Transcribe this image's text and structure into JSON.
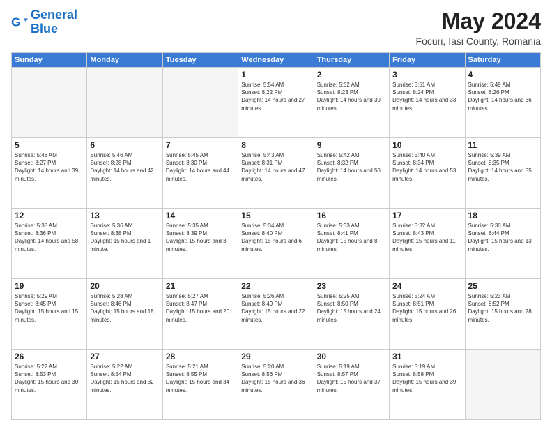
{
  "logo": {
    "line1": "General",
    "line2": "Blue"
  },
  "title": "May 2024",
  "subtitle": "Focuri, Iasi County, Romania",
  "weekdays": [
    "Sunday",
    "Monday",
    "Tuesday",
    "Wednesday",
    "Thursday",
    "Friday",
    "Saturday"
  ],
  "weeks": [
    [
      {
        "day": "",
        "empty": true
      },
      {
        "day": "",
        "empty": true
      },
      {
        "day": "",
        "empty": true
      },
      {
        "day": "1",
        "sunrise": "5:54 AM",
        "sunset": "8:22 PM",
        "daylight": "14 hours and 27 minutes."
      },
      {
        "day": "2",
        "sunrise": "5:52 AM",
        "sunset": "8:23 PM",
        "daylight": "14 hours and 30 minutes."
      },
      {
        "day": "3",
        "sunrise": "5:51 AM",
        "sunset": "8:24 PM",
        "daylight": "14 hours and 33 minutes."
      },
      {
        "day": "4",
        "sunrise": "5:49 AM",
        "sunset": "8:26 PM",
        "daylight": "14 hours and 36 minutes."
      }
    ],
    [
      {
        "day": "5",
        "sunrise": "5:48 AM",
        "sunset": "8:27 PM",
        "daylight": "14 hours and 39 minutes."
      },
      {
        "day": "6",
        "sunrise": "5:46 AM",
        "sunset": "8:28 PM",
        "daylight": "14 hours and 42 minutes."
      },
      {
        "day": "7",
        "sunrise": "5:45 AM",
        "sunset": "8:30 PM",
        "daylight": "14 hours and 44 minutes."
      },
      {
        "day": "8",
        "sunrise": "5:43 AM",
        "sunset": "8:31 PM",
        "daylight": "14 hours and 47 minutes."
      },
      {
        "day": "9",
        "sunrise": "5:42 AM",
        "sunset": "8:32 PM",
        "daylight": "14 hours and 50 minutes."
      },
      {
        "day": "10",
        "sunrise": "5:40 AM",
        "sunset": "8:34 PM",
        "daylight": "14 hours and 53 minutes."
      },
      {
        "day": "11",
        "sunrise": "5:39 AM",
        "sunset": "8:35 PM",
        "daylight": "14 hours and 55 minutes."
      }
    ],
    [
      {
        "day": "12",
        "sunrise": "5:38 AM",
        "sunset": "8:36 PM",
        "daylight": "14 hours and 58 minutes."
      },
      {
        "day": "13",
        "sunrise": "5:36 AM",
        "sunset": "8:38 PM",
        "daylight": "15 hours and 1 minute."
      },
      {
        "day": "14",
        "sunrise": "5:35 AM",
        "sunset": "8:39 PM",
        "daylight": "15 hours and 3 minutes."
      },
      {
        "day": "15",
        "sunrise": "5:34 AM",
        "sunset": "8:40 PM",
        "daylight": "15 hours and 6 minutes."
      },
      {
        "day": "16",
        "sunrise": "5:33 AM",
        "sunset": "8:41 PM",
        "daylight": "15 hours and 8 minutes."
      },
      {
        "day": "17",
        "sunrise": "5:32 AM",
        "sunset": "8:43 PM",
        "daylight": "15 hours and 11 minutes."
      },
      {
        "day": "18",
        "sunrise": "5:30 AM",
        "sunset": "8:44 PM",
        "daylight": "15 hours and 13 minutes."
      }
    ],
    [
      {
        "day": "19",
        "sunrise": "5:29 AM",
        "sunset": "8:45 PM",
        "daylight": "15 hours and 15 minutes."
      },
      {
        "day": "20",
        "sunrise": "5:28 AM",
        "sunset": "8:46 PM",
        "daylight": "15 hours and 18 minutes."
      },
      {
        "day": "21",
        "sunrise": "5:27 AM",
        "sunset": "8:47 PM",
        "daylight": "15 hours and 20 minutes."
      },
      {
        "day": "22",
        "sunrise": "5:26 AM",
        "sunset": "8:49 PM",
        "daylight": "15 hours and 22 minutes."
      },
      {
        "day": "23",
        "sunrise": "5:25 AM",
        "sunset": "8:50 PM",
        "daylight": "15 hours and 24 minutes."
      },
      {
        "day": "24",
        "sunrise": "5:24 AM",
        "sunset": "8:51 PM",
        "daylight": "15 hours and 26 minutes."
      },
      {
        "day": "25",
        "sunrise": "5:23 AM",
        "sunset": "8:52 PM",
        "daylight": "15 hours and 28 minutes."
      }
    ],
    [
      {
        "day": "26",
        "sunrise": "5:22 AM",
        "sunset": "8:53 PM",
        "daylight": "15 hours and 30 minutes."
      },
      {
        "day": "27",
        "sunrise": "5:22 AM",
        "sunset": "8:54 PM",
        "daylight": "15 hours and 32 minutes."
      },
      {
        "day": "28",
        "sunrise": "5:21 AM",
        "sunset": "8:55 PM",
        "daylight": "15 hours and 34 minutes."
      },
      {
        "day": "29",
        "sunrise": "5:20 AM",
        "sunset": "8:56 PM",
        "daylight": "15 hours and 36 minutes."
      },
      {
        "day": "30",
        "sunrise": "5:19 AM",
        "sunset": "8:57 PM",
        "daylight": "15 hours and 37 minutes."
      },
      {
        "day": "31",
        "sunrise": "5:19 AM",
        "sunset": "8:58 PM",
        "daylight": "15 hours and 39 minutes."
      },
      {
        "day": "",
        "empty": true
      }
    ]
  ]
}
